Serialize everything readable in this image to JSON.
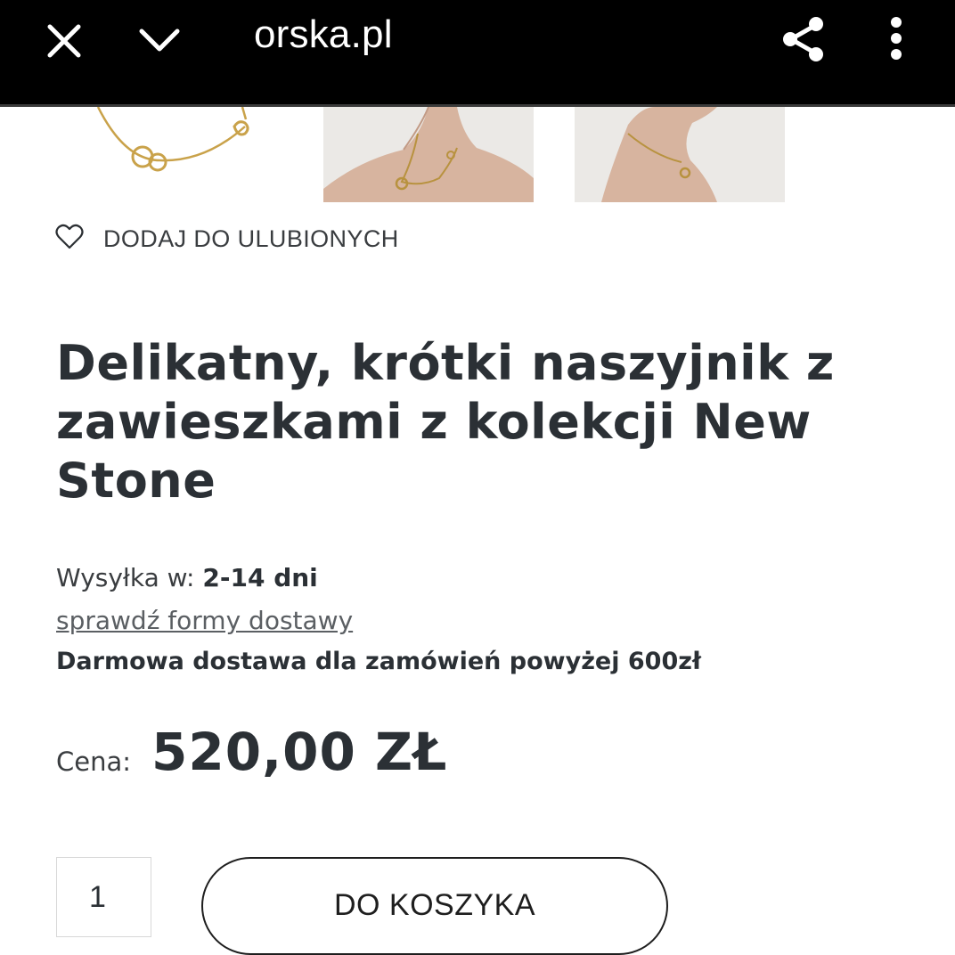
{
  "browser": {
    "url": "orska.pl",
    "icons": {
      "close": "close-icon",
      "collapse": "chevron-down-icon",
      "share": "share-icon",
      "menu": "more-vert-icon"
    }
  },
  "product": {
    "favorite_label": "DODAJ DO ULUBIONYCH",
    "title": "Delikatny, krótki naszyjnik z zawieszkami z kolekcji New Stone",
    "shipping": {
      "label": "Wysyłka w:",
      "value": "2-14 dni",
      "link": "sprawdź formy dostawy",
      "free_delivery": "Darmowa dostawa dla zamówień powyżej 600zł"
    },
    "price": {
      "label": "Cena:",
      "value": "520,00 ZŁ"
    },
    "quantity": "1",
    "add_to_cart": "DO KOSZYKA"
  },
  "colors": {
    "topbar": "#000000",
    "text": "#2b3035",
    "gold": "#c9a24a",
    "photo_background": "#ebe9e6"
  }
}
